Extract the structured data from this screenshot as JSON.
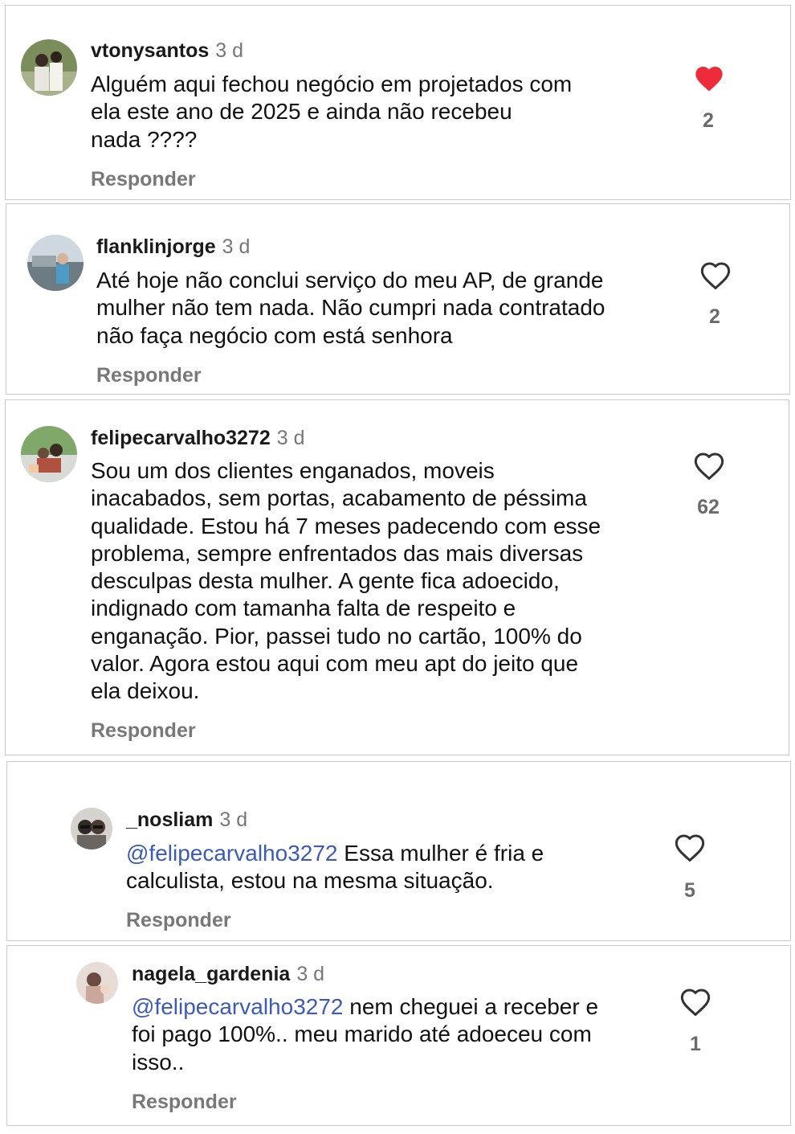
{
  "comments": [
    {
      "username": "vtonysantos",
      "time": "3 d",
      "lines": [
        "Alguém aqui fechou negócio em projetados  com",
        "ela este ano de 2025 e ainda não recebeu",
        "nada ????"
      ],
      "reply_label": "Responder",
      "likes": "2",
      "liked": true
    },
    {
      "username": "flanklinjorge",
      "time": "3 d",
      "lines": [
        "Até hoje não conclui serviço do meu AP, de grande",
        "mulher não tem nada. Não cumpri nada  contratado",
        "não faça negócio com está senhora"
      ],
      "reply_label": "Responder",
      "likes": "2",
      "liked": false
    },
    {
      "username": "felipecarvalho3272",
      "time": "3 d",
      "lines": [
        "Sou um dos clientes enganados, moveis",
        "inacabados, sem portas, acabamento de péssima",
        "qualidade. Estou há 7 meses padecendo com esse",
        "problema, sempre enfrentados das mais diversas",
        "desculpas desta mulher. A gente fica adoecido,",
        "indignado com tamanha falta de respeito  e",
        "enganação. Pior, passei tudo no cartão, 100% do",
        "valor. Agora estou aqui com meu apt do jeito que",
        "ela deixou."
      ],
      "reply_label": "Responder",
      "likes": "62",
      "liked": false
    },
    {
      "username": "_nosliam",
      "time": "3 d",
      "mention": "@felipecarvalho3272",
      "lines": [
        " Essa mulher é fria e",
        "calculista, estou na mesma situação."
      ],
      "reply_label": "Responder",
      "likes": "5",
      "liked": false
    },
    {
      "username": "nagela_gardenia",
      "time": "3 d",
      "mention": "@felipecarvalho3272",
      "lines": [
        " nem cheguei a receber e",
        "foi pago 100%.. meu marido até adoeceu com",
        "isso.."
      ],
      "reply_label": "Responder",
      "likes": "1",
      "liked": false
    }
  ],
  "icons": {
    "liked": "heart-filled-icon",
    "not_liked": "heart-outline-icon"
  },
  "colors": {
    "like_red": "#ee2b3b",
    "mention_blue": "#3c5bb8",
    "muted_gray": "#787878"
  }
}
